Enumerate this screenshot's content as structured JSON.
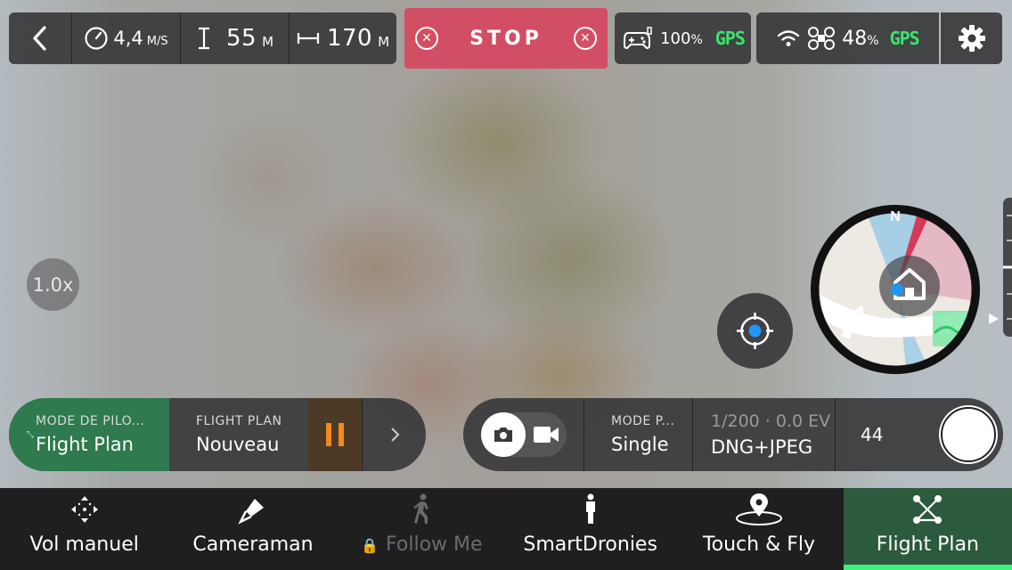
{
  "topbar": {
    "speed_value": "4,4",
    "speed_unit": "M/S",
    "altitude_value": "55",
    "altitude_unit": "M",
    "distance_value": "170",
    "distance_unit": "M",
    "stop_label": "STOP",
    "controller_battery": "100",
    "controller_gps": "GPS",
    "drone_battery": "48",
    "drone_gps": "GPS",
    "percent": "%"
  },
  "zoom_label": "1.0x",
  "compass": {
    "north_label": "N"
  },
  "pilot_panel": {
    "mode_label": "MODE DE PILO...",
    "mode_value": "Flight Plan",
    "plan_label": "FLIGHT PLAN",
    "plan_value": "Nouveau"
  },
  "camera_panel": {
    "photo_mode_label": "MODE P...",
    "photo_mode_value": "Single",
    "exposure": "1/200 · 0.0 EV",
    "format": "DNG+JPEG",
    "shot_count": "44"
  },
  "nav": {
    "tabs": [
      {
        "label": "Vol manuel",
        "icon": "move-arrows-icon",
        "state": "normal"
      },
      {
        "label": "Cameraman",
        "icon": "pen-icon",
        "state": "normal"
      },
      {
        "label": "Follow Me",
        "icon": "walking-person-icon",
        "state": "locked"
      },
      {
        "label": "SmartDronies",
        "icon": "person-icon",
        "state": "normal"
      },
      {
        "label": "Touch & Fly",
        "icon": "map-pin-icon",
        "state": "normal"
      },
      {
        "label": "Flight Plan",
        "icon": "flight-plan-icon",
        "state": "active"
      }
    ]
  },
  "colors": {
    "accent_green": "#3ef07c",
    "gps_green": "#39e46b",
    "stop_red": "#d64660",
    "pause_orange": "#f28a1b",
    "active_tab": "#2b5a3e"
  }
}
